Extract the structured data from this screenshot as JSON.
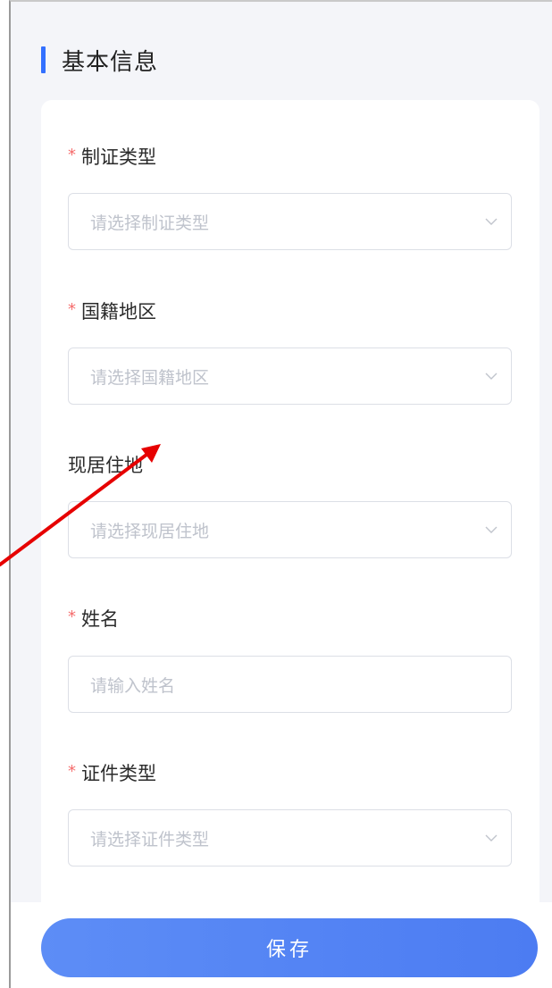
{
  "section": {
    "title": "基本信息"
  },
  "form": {
    "fields": [
      {
        "label": "制证类型",
        "required": true,
        "placeholder": "请选择制证类型",
        "kind": "select"
      },
      {
        "label": "国籍地区",
        "required": true,
        "placeholder": "请选择国籍地区",
        "kind": "select"
      },
      {
        "label": "现居住地",
        "required": false,
        "placeholder": "请选择现居住地",
        "kind": "select"
      },
      {
        "label": "姓名",
        "required": true,
        "placeholder": "请输入姓名",
        "kind": "input"
      },
      {
        "label": "证件类型",
        "required": true,
        "placeholder": "请选择证件类型",
        "kind": "select"
      }
    ],
    "required_mark": "*"
  },
  "footer": {
    "save_label": "保存"
  },
  "colors": {
    "accent": "#3370ff",
    "required": "#f56c6c",
    "button": "#5d8df6",
    "annotation_arrow": "#e60000"
  },
  "icons": {
    "dropdown": "chevron-down-icon"
  }
}
